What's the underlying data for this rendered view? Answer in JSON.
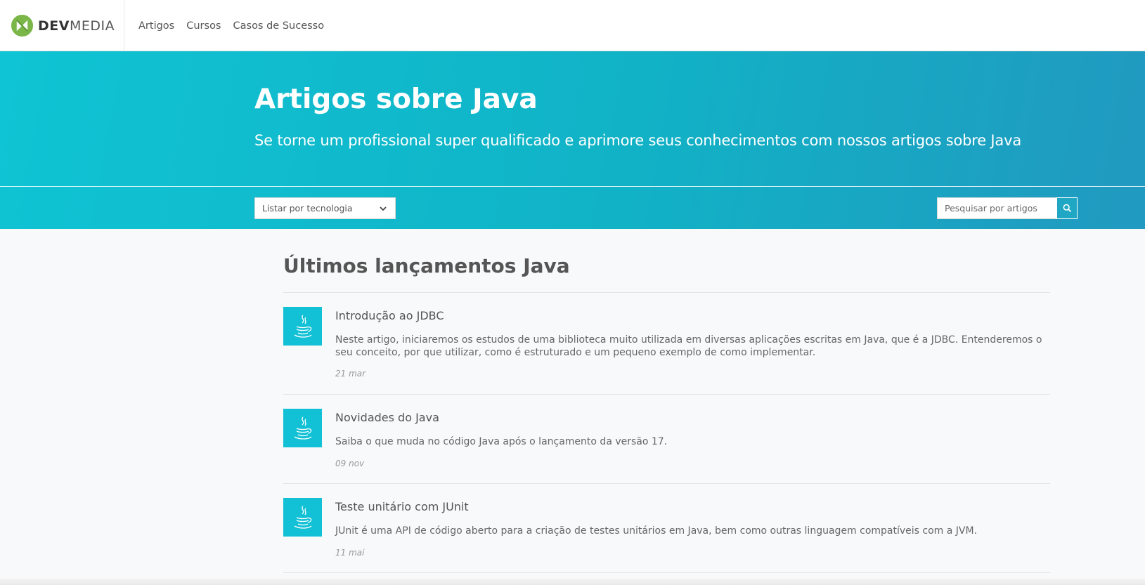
{
  "header": {
    "logo_dev": "DEV",
    "logo_media": "MEDIA",
    "nav": [
      "Artigos",
      "Cursos",
      "Casos de Sucesso"
    ]
  },
  "hero": {
    "title": "Artigos sobre Java",
    "subtitle": "Se torne um profissional super qualificado e aprimore seus conhecimentos com nossos artigos sobre Java",
    "select_label": "Listar por tecnologia",
    "search_placeholder": "Pesquisar por artigos"
  },
  "main": {
    "section_title": "Últimos lançamentos Java",
    "articles": [
      {
        "title": "Introdução ao JDBC",
        "description": "Neste artigo, iniciaremos os estudos de uma biblioteca muito utilizada em diversas aplicações escritas em Java, que é a JDBC. Entenderemos o seu conceito, por que utilizar, como é estruturado e um pequeno exemplo de como implementar.",
        "date": "21 mar"
      },
      {
        "title": "Novidades do Java",
        "description": "Saiba o que muda no código Java após o lançamento da versão 17.",
        "date": "09 nov"
      },
      {
        "title": "Teste unitário com JUnit",
        "description": "JUnit é uma API de código aberto para a criação de testes unitários em Java, bem como outras linguagem compatíveis com a JVM.",
        "date": "11 mai"
      }
    ]
  },
  "colors": {
    "accent": "#13c1d6",
    "logo_green": "#7ab648",
    "hero_start": "#0fc4d4",
    "hero_end": "#2199c0"
  },
  "icons": {
    "logo": "devmedia-logo-icon",
    "select": "chevron-down-icon",
    "search": "search-icon",
    "article": "java-cup-icon"
  }
}
